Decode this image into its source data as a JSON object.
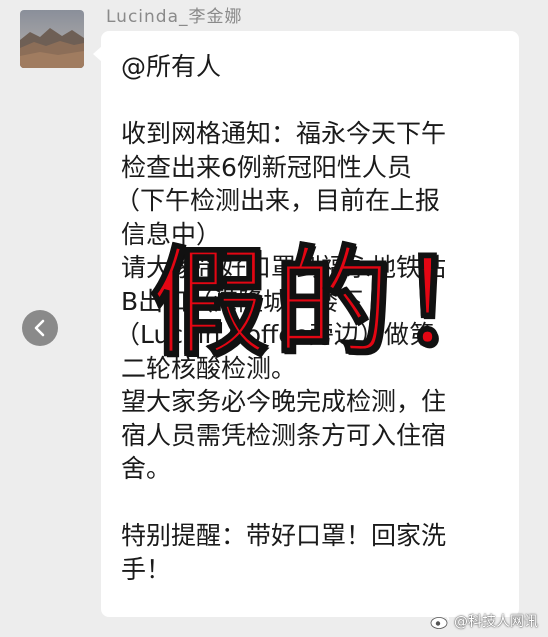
{
  "sender": {
    "name": "Lucinda_李金娜"
  },
  "message": {
    "lines": [
      "@所有人",
      "",
      "收到网格通知：福永今天下午",
      "检查出来6例新冠阳性人员",
      "（下午检测出来，目前在上报",
      "信息中）",
      "请大家带好口罩到福永地铁站",
      "B出口（港隆城）楼下",
      "（Luckin Coffee旁边）做第",
      "二轮核酸检测。",
      "望大家务必今晚完成检测，住",
      "宿人员需凭检测条方可入住宿",
      "舍。",
      "",
      "特别提醒：带好口罩！回家洗",
      "手！"
    ]
  },
  "overlay": {
    "stamp_text": "假的！"
  },
  "watermark": {
    "text": "@科技人网讯"
  },
  "colors": {
    "bubble": "#ffffff",
    "background": "#ededed",
    "stamp": "#e30613"
  },
  "icons": {
    "back": "chevron-left-icon",
    "weibo": "weibo-icon"
  }
}
